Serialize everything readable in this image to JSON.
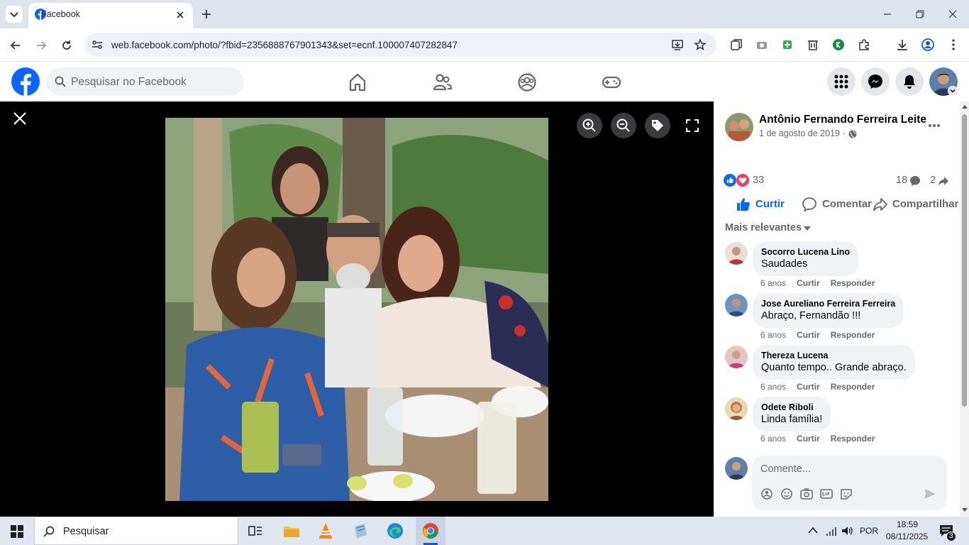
{
  "browser": {
    "tab_title": "Facebook",
    "url": "web.facebook.com/photo/?fbid=2356888767901343&set=ecnf.100007407282847"
  },
  "fb_header": {
    "search_placeholder": "Pesquisar no Facebook",
    "accent_color": "#0866ff"
  },
  "post": {
    "author": "Antônio Fernando Ferreira Leite",
    "date": "1 de agosto de 2019 ·",
    "reactions_count": "33",
    "comments_count": "18",
    "shares_count": "2",
    "actions": {
      "like": "Curtir",
      "comment": "Comentar",
      "share": "Compartilhar"
    },
    "sort_label": "Mais relevantes"
  },
  "comments": [
    {
      "name": "Socorro Lucena Lino",
      "text": "Saudades",
      "age": "6 anos",
      "like": "Curtir",
      "reply": "Responder"
    },
    {
      "name": "Jose Aureliano Ferreira Ferreira",
      "text": "Abraço, Fernandão !!!",
      "age": "6 anos",
      "like": "Curtir",
      "reply": "Responder"
    },
    {
      "name": "Thereza Lucena",
      "text": "Quanto tempo.. Grande abraço.",
      "age": "6 anos",
      "like": "Curtir",
      "reply": "Responder"
    },
    {
      "name": "Odete Riboli",
      "text": "Linda família!",
      "age": "6 anos",
      "like": "Curtir",
      "reply": "Responder"
    }
  ],
  "composer": {
    "placeholder": "Comente..."
  },
  "taskbar": {
    "search_label": "Pesquisar",
    "language": "POR",
    "time": "18:59",
    "date": "08/11/2025",
    "notification_count": "3"
  }
}
